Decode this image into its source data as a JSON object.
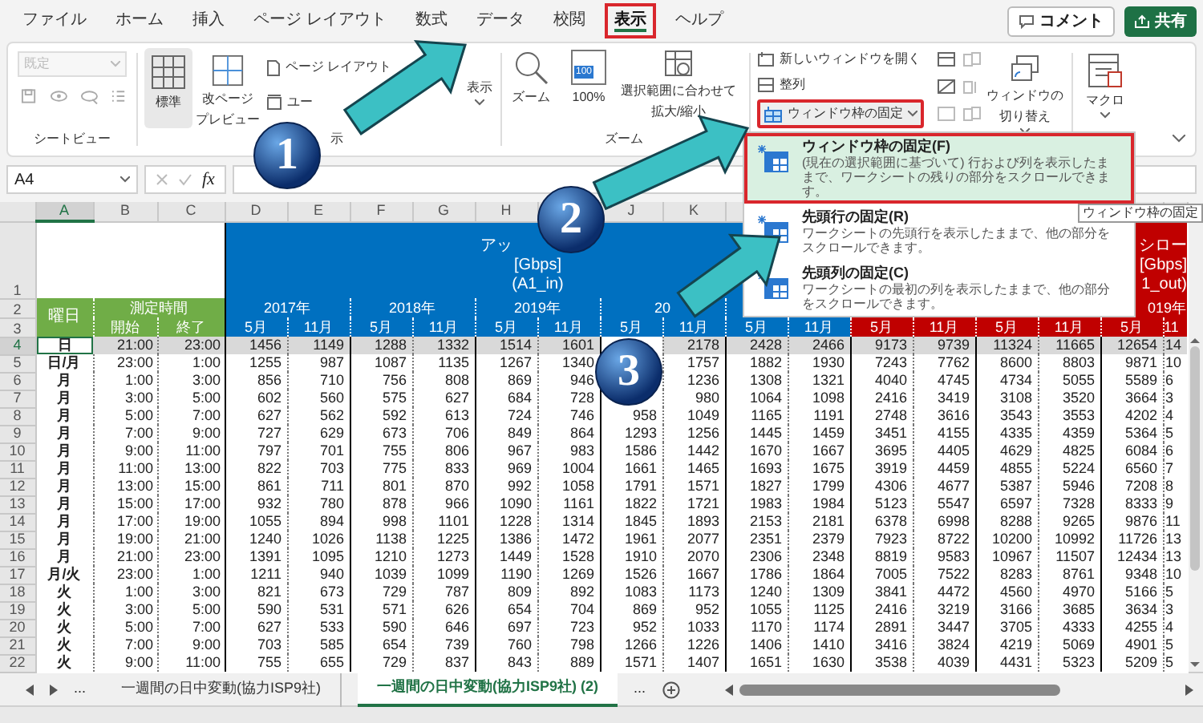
{
  "ribbon_tabs": [
    {
      "label": "ファイル",
      "selected": false,
      "highlighted": false
    },
    {
      "label": "ホーム",
      "selected": false,
      "highlighted": false
    },
    {
      "label": "挿入",
      "selected": false,
      "highlighted": false
    },
    {
      "label": "ページ レイアウト",
      "selected": false,
      "highlighted": false
    },
    {
      "label": "数式",
      "selected": false,
      "highlighted": false
    },
    {
      "label": "データ",
      "selected": false,
      "highlighted": false
    },
    {
      "label": "校閲",
      "selected": false,
      "highlighted": false
    },
    {
      "label": "表示",
      "selected": true,
      "highlighted": true
    },
    {
      "label": "ヘルプ",
      "selected": false,
      "highlighted": false
    }
  ],
  "header_buttons": [
    {
      "kind": "comment",
      "label": "コメント"
    },
    {
      "kind": "share",
      "label": "共有"
    }
  ],
  "ribbon": {
    "sheet_view_dropdown": {
      "value": "既定",
      "disabled": true
    },
    "sheet_view_label": "シートビュー",
    "normal_button": {
      "label": "標準",
      "selected": true
    },
    "page_break_button": [
      "改ページ",
      "プレビュー"
    ],
    "page_layout_button": "ページ レイアウト",
    "custom_view_button": "ユー",
    "workbook_views_label": "示",
    "show_button": "表示",
    "zoom_button": "ズーム",
    "zoom_100_badge": "100",
    "zoom_100_button": "100%",
    "zoom_selection_button": [
      "選択範囲に合わせて",
      "拡大/縮小"
    ],
    "zoom_label": "ズーム",
    "new_window_button": "新しいウィンドウを開く",
    "arrange_button": "整列",
    "freeze_button": {
      "label": "ウィンドウ枠の固定",
      "highlighted": true
    },
    "switch_window_button": [
      "ウィンドウの",
      "切り替え"
    ],
    "macro_button": "マクロ"
  },
  "formula_bar": {
    "name_box": "A4",
    "function_label": "fx"
  },
  "freeze_menu": {
    "items": [
      {
        "title": "ウィンドウ枠の固定(F)",
        "description": "(現在の選択範囲に基づいて) 行および列を表示したままで、ワークシートの残りの部分をスクロールできます。",
        "highlighted": true
      },
      {
        "title": "先頭行の固定(R)",
        "description": "ワークシートの先頭行を表示したままで、他の部分をスクロールできます。",
        "highlighted": false
      },
      {
        "title": "先頭列の固定(C)",
        "description": "ワークシートの最初の列を表示したままで、他の部分をスクロールできます。",
        "highlighted": false
      }
    ],
    "tooltip": "ウィンドウ枠の固定"
  },
  "sheet": {
    "column_headers": {
      "A": {
        "label": "A",
        "selected": true
      },
      "B": {
        "label": "B",
        "selected": false
      },
      "C": {
        "label": "C",
        "selected": false
      },
      "D": {
        "label": "D",
        "selected": false
      },
      "E": {
        "label": "E",
        "selected": false
      },
      "F": {
        "label": "F",
        "selected": false
      },
      "G": {
        "label": "G",
        "selected": false
      },
      "H": {
        "label": "H",
        "selected": false
      },
      "J": {
        "label": "J",
        "selected": false
      },
      "K": {
        "label": "K",
        "selected": false
      }
    },
    "header": {
      "row_numbers": [
        "1",
        "2",
        "3"
      ],
      "title_in": [
        "アッ",
        "[Gbps]",
        "(A1_in)"
      ],
      "title_out": [
        "シロー",
        "[Gbps]",
        "1_out)"
      ],
      "day_label": "曜日",
      "time_label": "測定時間",
      "start_label": "開始",
      "end_label": "終了",
      "years": {
        "D": "2017年",
        "F": "2018年",
        "H": "2019年",
        "J": "20",
        "R": "019年"
      },
      "months": [
        "5月",
        "11月",
        "5月",
        "11月",
        "5月",
        "11月",
        "5月",
        "11月",
        "5月",
        "11月",
        "5月",
        "11月",
        "5月",
        "11月",
        "5月",
        "11"
      ]
    },
    "rows": [
      {
        "num": "4",
        "day": "日",
        "start": "21:00",
        "end": "23:00",
        "selected": true,
        "cells": {
          "D": "1456",
          "E": "1149",
          "F": "1288",
          "G": "1332",
          "H": "1514",
          "I": "1601",
          "K": "2178",
          "L": "2428",
          "M": "2466",
          "N": "9173",
          "O": "9739",
          "P": "11324",
          "Q": "11665",
          "R": "12654",
          "S": "14"
        }
      },
      {
        "num": "5",
        "day": "日/月",
        "start": "23:00",
        "end": "1:00",
        "selected": false,
        "cells": {
          "D": "1255",
          "E": "987",
          "F": "1087",
          "G": "1135",
          "H": "1267",
          "I": "1340",
          "K": "1757",
          "L": "1882",
          "M": "1930",
          "N": "7243",
          "O": "7762",
          "P": "8600",
          "Q": "8803",
          "R": "9871",
          "S": "10"
        }
      },
      {
        "num": "6",
        "day": "月",
        "start": "1:00",
        "end": "3:00",
        "selected": false,
        "cells": {
          "D": "856",
          "E": "710",
          "F": "756",
          "G": "808",
          "H": "869",
          "I": "946",
          "K": "1236",
          "L": "1308",
          "M": "1321",
          "N": "4040",
          "O": "4745",
          "P": "4734",
          "Q": "5055",
          "R": "5589",
          "S": "6"
        }
      },
      {
        "num": "7",
        "day": "月",
        "start": "3:00",
        "end": "5:00",
        "selected": false,
        "cells": {
          "D": "602",
          "E": "560",
          "F": "575",
          "G": "627",
          "H": "684",
          "I": "728",
          "K": "980",
          "L": "1064",
          "M": "1098",
          "N": "2416",
          "O": "3419",
          "P": "3108",
          "Q": "3520",
          "R": "3664",
          "S": "3"
        }
      },
      {
        "num": "8",
        "day": "月",
        "start": "5:00",
        "end": "7:00",
        "selected": false,
        "cells": {
          "D": "627",
          "E": "562",
          "F": "592",
          "G": "613",
          "H": "724",
          "I": "746",
          "J": "958",
          "K": "1049",
          "L": "1165",
          "M": "1191",
          "N": "2748",
          "O": "3616",
          "P": "3543",
          "Q": "3553",
          "R": "4202",
          "S": "4"
        }
      },
      {
        "num": "9",
        "day": "月",
        "start": "7:00",
        "end": "9:00",
        "selected": false,
        "cells": {
          "D": "727",
          "E": "629",
          "F": "673",
          "G": "706",
          "H": "849",
          "I": "864",
          "J": "1293",
          "K": "1256",
          "L": "1445",
          "M": "1459",
          "N": "3451",
          "O": "4155",
          "P": "4335",
          "Q": "4359",
          "R": "5364",
          "S": "5"
        }
      },
      {
        "num": "10",
        "day": "月",
        "start": "9:00",
        "end": "11:00",
        "selected": false,
        "cells": {
          "D": "797",
          "E": "701",
          "F": "755",
          "G": "806",
          "H": "967",
          "I": "983",
          "J": "1586",
          "K": "1442",
          "L": "1670",
          "M": "1667",
          "N": "3695",
          "O": "4405",
          "P": "4629",
          "Q": "4825",
          "R": "6084",
          "S": "6"
        }
      },
      {
        "num": "11",
        "day": "月",
        "start": "11:00",
        "end": "13:00",
        "selected": false,
        "cells": {
          "D": "822",
          "E": "703",
          "F": "775",
          "G": "833",
          "H": "969",
          "I": "1004",
          "J": "1661",
          "K": "1465",
          "L": "1693",
          "M": "1675",
          "N": "3919",
          "O": "4459",
          "P": "4855",
          "Q": "5224",
          "R": "6560",
          "S": "7"
        }
      },
      {
        "num": "12",
        "day": "月",
        "start": "13:00",
        "end": "15:00",
        "selected": false,
        "cells": {
          "D": "861",
          "E": "711",
          "F": "801",
          "G": "870",
          "H": "992",
          "I": "1058",
          "J": "1791",
          "K": "1571",
          "L": "1827",
          "M": "1799",
          "N": "4306",
          "O": "4677",
          "P": "5387",
          "Q": "5946",
          "R": "7208",
          "S": "8"
        }
      },
      {
        "num": "13",
        "day": "月",
        "start": "15:00",
        "end": "17:00",
        "selected": false,
        "cells": {
          "D": "932",
          "E": "780",
          "F": "878",
          "G": "966",
          "H": "1090",
          "I": "1161",
          "J": "1822",
          "K": "1721",
          "L": "1983",
          "M": "1984",
          "N": "5123",
          "O": "5547",
          "P": "6597",
          "Q": "7328",
          "R": "8333",
          "S": "9"
        }
      },
      {
        "num": "14",
        "day": "月",
        "start": "17:00",
        "end": "19:00",
        "selected": false,
        "cells": {
          "D": "1055",
          "E": "894",
          "F": "998",
          "G": "1101",
          "H": "1228",
          "I": "1314",
          "J": "1845",
          "K": "1893",
          "L": "2153",
          "M": "2181",
          "N": "6378",
          "O": "6998",
          "P": "8288",
          "Q": "9265",
          "R": "9876",
          "S": "11"
        }
      },
      {
        "num": "15",
        "day": "月",
        "start": "19:00",
        "end": "21:00",
        "selected": false,
        "cells": {
          "D": "1240",
          "E": "1026",
          "F": "1138",
          "G": "1225",
          "H": "1386",
          "I": "1472",
          "J": "1961",
          "K": "2077",
          "L": "2351",
          "M": "2379",
          "N": "7923",
          "O": "8722",
          "P": "10200",
          "Q": "10992",
          "R": "11726",
          "S": "13"
        }
      },
      {
        "num": "16",
        "day": "月",
        "start": "21:00",
        "end": "23:00",
        "selected": false,
        "cells": {
          "D": "1391",
          "E": "1095",
          "F": "1210",
          "G": "1273",
          "H": "1449",
          "I": "1528",
          "J": "1910",
          "K": "2070",
          "L": "2306",
          "M": "2348",
          "N": "8819",
          "O": "9583",
          "P": "10967",
          "Q": "11507",
          "R": "12434",
          "S": "13"
        }
      },
      {
        "num": "17",
        "day": "月/火",
        "start": "23:00",
        "end": "1:00",
        "selected": false,
        "cells": {
          "D": "1211",
          "E": "940",
          "F": "1039",
          "G": "1099",
          "H": "1190",
          "I": "1269",
          "J": "1526",
          "K": "1667",
          "L": "1786",
          "M": "1864",
          "N": "7005",
          "O": "7522",
          "P": "8283",
          "Q": "8761",
          "R": "9348",
          "S": "10"
        }
      },
      {
        "num": "18",
        "day": "火",
        "start": "1:00",
        "end": "3:00",
        "selected": false,
        "cells": {
          "D": "821",
          "E": "673",
          "F": "729",
          "G": "787",
          "H": "809",
          "I": "892",
          "J": "1083",
          "K": "1173",
          "L": "1240",
          "M": "1309",
          "N": "3841",
          "O": "4472",
          "P": "4560",
          "Q": "4970",
          "R": "5166",
          "S": "5"
        }
      },
      {
        "num": "19",
        "day": "火",
        "start": "3:00",
        "end": "5:00",
        "selected": false,
        "cells": {
          "D": "590",
          "E": "531",
          "F": "571",
          "G": "626",
          "H": "654",
          "I": "704",
          "J": "869",
          "K": "952",
          "L": "1055",
          "M": "1125",
          "N": "2416",
          "O": "3219",
          "P": "3166",
          "Q": "3685",
          "R": "3634",
          "S": "3"
        }
      },
      {
        "num": "20",
        "day": "火",
        "start": "5:00",
        "end": "7:00",
        "selected": false,
        "cells": {
          "D": "627",
          "E": "533",
          "F": "590",
          "G": "646",
          "H": "697",
          "I": "723",
          "J": "952",
          "K": "1033",
          "L": "1170",
          "M": "1174",
          "N": "2891",
          "O": "3447",
          "P": "3705",
          "Q": "4333",
          "R": "4255",
          "S": "4"
        }
      },
      {
        "num": "21",
        "day": "火",
        "start": "7:00",
        "end": "9:00",
        "selected": false,
        "cells": {
          "D": "703",
          "E": "585",
          "F": "654",
          "G": "739",
          "H": "760",
          "I": "798",
          "J": "1266",
          "K": "1226",
          "L": "1406",
          "M": "1410",
          "N": "3416",
          "O": "3824",
          "P": "4219",
          "Q": "5069",
          "R": "4901",
          "S": "5"
        }
      },
      {
        "num": "22",
        "day": "火",
        "start": "9:00",
        "end": "11:00",
        "selected": false,
        "cells": {
          "D": "755",
          "E": "655",
          "F": "729",
          "G": "837",
          "H": "843",
          "I": "889",
          "J": "1571",
          "K": "1407",
          "L": "1651",
          "M": "1630",
          "N": "3538",
          "O": "4039",
          "P": "4431",
          "Q": "5323",
          "R": "5209",
          "S": "5"
        }
      }
    ]
  },
  "sheet_tabs": {
    "more_left": "...",
    "tabs": [
      {
        "label": "一週間の日中変動(協力ISP9社)",
        "selected": false
      },
      {
        "label": "一週間の日中変動(協力ISP9社) (2)",
        "selected": true
      }
    ],
    "more_right": "..."
  },
  "callouts": [
    {
      "label": "1"
    },
    {
      "label": "2"
    },
    {
      "label": "3"
    }
  ]
}
